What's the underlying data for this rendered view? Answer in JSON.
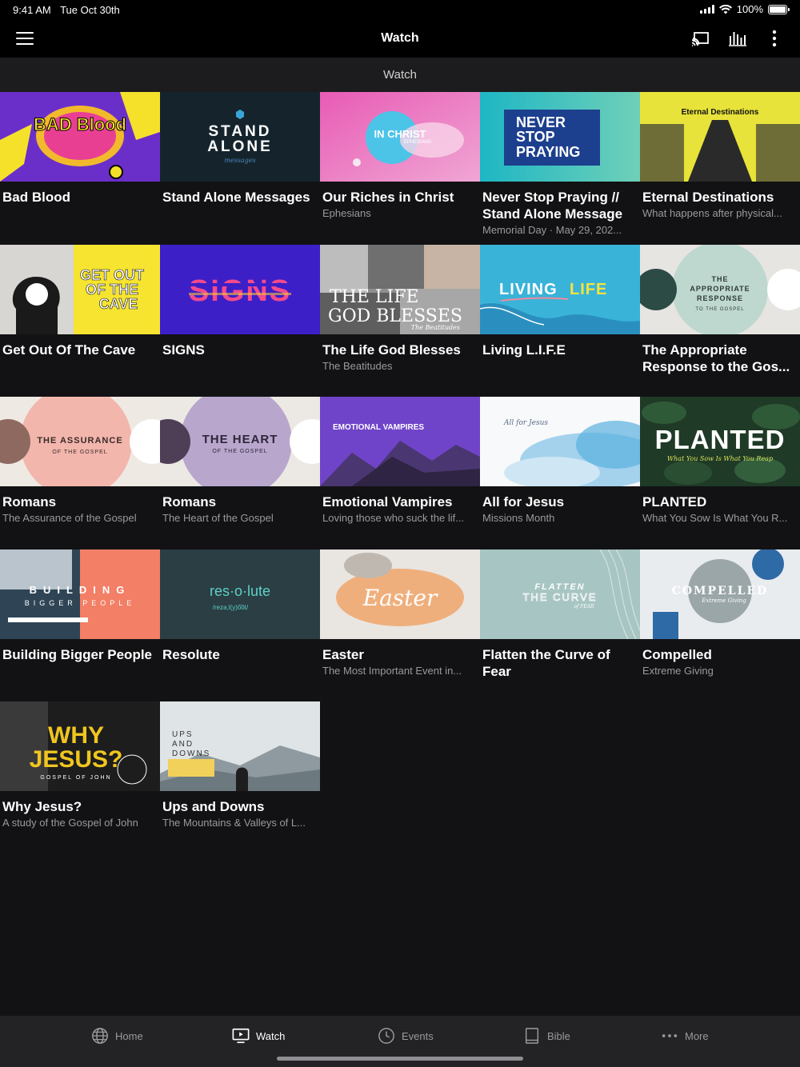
{
  "status": {
    "time": "9:41 AM",
    "date": "Tue Oct 30th",
    "battery": "100%",
    "battery_level": 1.0
  },
  "nav": {
    "title": "Watch"
  },
  "section": {
    "title": "Watch"
  },
  "tiles": [
    {
      "title": "Bad Blood",
      "subtitle": "",
      "thumb_text": "BAD Blood",
      "icon": "bad-blood-art"
    },
    {
      "title": "Stand Alone Messages",
      "subtitle": "",
      "thumb_text": "STAND ALONE",
      "thumb_sub": "messages",
      "icon": "stand-alone-art"
    },
    {
      "title": "Our Riches in Christ",
      "subtitle": "Ephesians",
      "thumb_text": "IN CHRIST",
      "thumb_sub": "EPHESIANS",
      "icon": "in-christ-art"
    },
    {
      "title": "Never Stop Praying // Stand Alone Message",
      "subtitle": "Memorial Day · May 29, 202...",
      "thumb_text": "NEVER STOP PRAYING",
      "icon": "never-stop-praying-art"
    },
    {
      "title": "Eternal Destinations",
      "subtitle": "What happens after physical...",
      "thumb_text": "Eternal Destinations",
      "icon": "eternal-destinations-art"
    },
    {
      "title": "Get Out Of The Cave",
      "subtitle": "",
      "thumb_text": "GET OUT OF THE CAVE",
      "icon": "cave-art"
    },
    {
      "title": "SIGNS",
      "subtitle": "",
      "thumb_text": "SIGNS",
      "icon": "signs-art"
    },
    {
      "title": "The Life God Blesses",
      "subtitle": "The Beatitudes",
      "thumb_text": "THE LIFE GOD BLESSES",
      "thumb_sub": "The Beatitudes",
      "icon": "life-god-blesses-art"
    },
    {
      "title": "Living L.I.F.E",
      "subtitle": "",
      "thumb_text": "LIVING LIFE",
      "icon": "living-life-art"
    },
    {
      "title": "The Appropriate Response to the Gos...",
      "subtitle": "",
      "thumb_text": "THE APPROPRIATE RESPONSE",
      "thumb_sub": "TO THE GOSPEL",
      "icon": "appropriate-response-art"
    },
    {
      "title": "Romans",
      "subtitle": "The Assurance of the Gospel",
      "thumb_text": "THE ASSURANCE",
      "thumb_sub": "OF THE GOSPEL",
      "icon": "assurance-art"
    },
    {
      "title": "Romans",
      "subtitle": "The Heart of the Gospel",
      "thumb_text": "THE HEART",
      "thumb_sub": "OF THE GOSPEL",
      "icon": "heart-art"
    },
    {
      "title": "Emotional Vampires",
      "subtitle": "Loving those who suck the lif...",
      "thumb_text": "EMOTIONAL VAMPIRES",
      "icon": "vampires-art"
    },
    {
      "title": "All for Jesus",
      "subtitle": "Missions Month",
      "thumb_text": "All for Jesus",
      "icon": "all-for-jesus-art"
    },
    {
      "title": "PLANTED",
      "subtitle": "What You Sow Is What You R...",
      "thumb_text": "PLANTED",
      "thumb_sub": "What You Sow Is What You Reap",
      "icon": "planted-art"
    },
    {
      "title": "Building Bigger People",
      "subtitle": "",
      "thumb_text": "BUILDING",
      "thumb_sub": "BIGGER PEOPLE",
      "icon": "building-art"
    },
    {
      "title": "Resolute",
      "subtitle": "",
      "thumb_text": "res·o·lute",
      "thumb_sub": "/rezə,l(y)o͞ot/",
      "icon": "resolute-art"
    },
    {
      "title": "Easter",
      "subtitle": "The Most Important Event in...",
      "thumb_text": "Easter",
      "icon": "easter-art"
    },
    {
      "title": "Flatten the Curve of Fear",
      "subtitle": "",
      "thumb_text": "FLATTEN THE CURVE",
      "thumb_sub": "of FEAR",
      "icon": "flatten-art"
    },
    {
      "title": "Compelled",
      "subtitle": "Extreme Giving",
      "thumb_text": "COMPELLED",
      "thumb_sub": "Extreme Giving",
      "icon": "compelled-art"
    },
    {
      "title": "Why Jesus?",
      "subtitle": "A study of the Gospel of John",
      "thumb_text": "WHY JESUS?",
      "thumb_sub": "GOSPEL OF JOHN",
      "icon": "why-jesus-art"
    },
    {
      "title": "Ups and Downs",
      "subtitle": "The Mountains & Valleys of L...",
      "thumb_text": "UPS AND DOWNS",
      "icon": "ups-downs-art"
    }
  ],
  "tabs": [
    {
      "label": "Home",
      "icon": "globe-icon"
    },
    {
      "label": "Watch",
      "icon": "tv-icon",
      "active": true
    },
    {
      "label": "Events",
      "icon": "clock-icon"
    },
    {
      "label": "Bible",
      "icon": "book-icon"
    },
    {
      "label": "More",
      "icon": "ellipsis-icon"
    }
  ]
}
